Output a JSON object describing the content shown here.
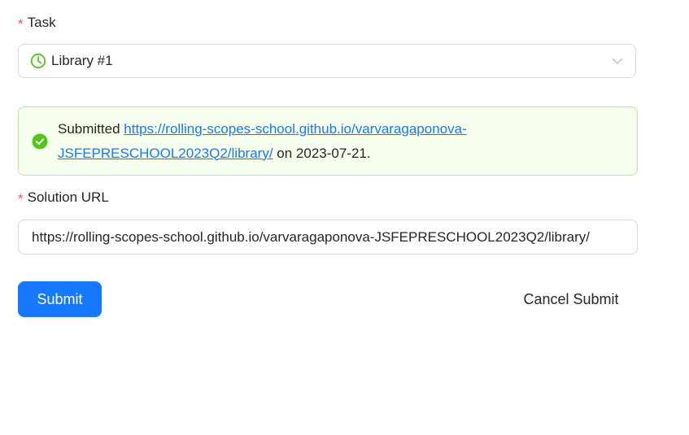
{
  "task_field": {
    "label": "Task",
    "required_mark": "*",
    "selected_value": "Library #1",
    "icon": "clock-icon"
  },
  "alert": {
    "status": "success",
    "prefix": "Submitted",
    "link_text": "https://rolling-scopes-school.github.io/varvaragaponova-JSFEPRESCHOOL2023Q2/library/",
    "suffix": "on 2023-07-21.",
    "icon": "check-circle-icon"
  },
  "solution_field": {
    "label": "Solution URL",
    "required_mark": "*",
    "value": "https://rolling-scopes-school.github.io/varvaragaponova-JSFEPRESCHOOL2023Q2/library/"
  },
  "actions": {
    "submit_label": "Submit",
    "cancel_label": "Cancel Submit"
  },
  "colors": {
    "primary": "#1677ff",
    "required": "#ff4d4f",
    "success_icon": "#52c41a",
    "success_bg": "#f6ffed",
    "success_border": "#b7eb8f"
  }
}
